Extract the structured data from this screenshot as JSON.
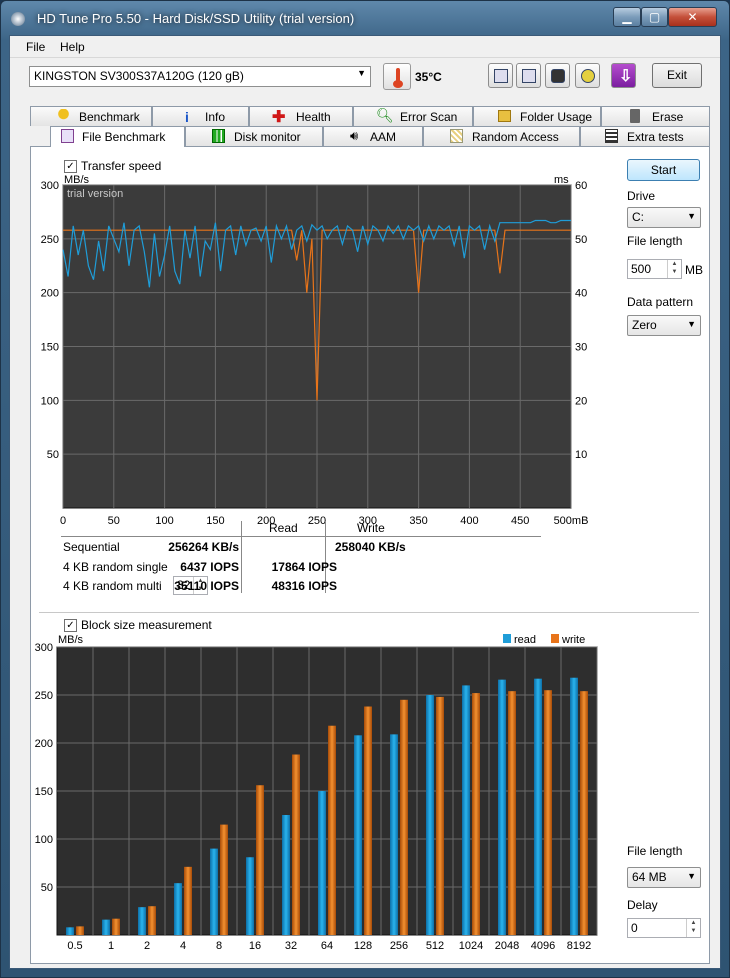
{
  "window": {
    "title": "HD Tune Pro 5.50 - Hard Disk/SSD Utility (trial version)",
    "minimize": "▁",
    "maximize": "▢",
    "close": "✕"
  },
  "menu": {
    "file": "File",
    "help": "Help"
  },
  "toolbar": {
    "drive": "KINGSTON SV300S37A120G (120 gB)",
    "temperature": "35°C",
    "exit": "Exit"
  },
  "tabs_top": [
    "Benchmark",
    "Info",
    "Health",
    "Error Scan",
    "Folder Usage",
    "Erase"
  ],
  "tabs_bottom": [
    "File Benchmark",
    "Disk monitor",
    "AAM",
    "Random Access",
    "Extra tests"
  ],
  "side": {
    "start": "Start",
    "drive_label": "Drive",
    "drive_value": "C:",
    "file_length_label": "File length",
    "file_length_value": "500",
    "file_length_unit": "MB",
    "data_pattern_label": "Data pattern",
    "data_pattern_value": "Zero",
    "file_length2_label": "File length",
    "file_length2_value": "64 MB",
    "delay_label": "Delay",
    "delay_value": "0"
  },
  "transfer": {
    "checkbox_label": "Transfer speed",
    "checked": true,
    "y_unit": "MB/s",
    "y2_unit": "ms",
    "watermark": "trial version",
    "x_unit": "500mB"
  },
  "results": {
    "col_read": "Read",
    "col_write": "Write",
    "rows": [
      {
        "label": "Sequential",
        "read": "256264 KB/s",
        "write": "258040 KB/s"
      },
      {
        "label": "4 KB random single",
        "read": "6437 IOPS",
        "write": "17864 IOPS"
      },
      {
        "label": "4 KB random multi",
        "read": "35110 IOPS",
        "write": "48316 IOPS"
      }
    ],
    "multi_queue": "32"
  },
  "block": {
    "checkbox_label": "Block size measurement",
    "checked": true,
    "y_unit": "MB/s",
    "legend_read": "read",
    "legend_write": "write"
  },
  "colors": {
    "read": "#1f9dd8",
    "write": "#e8741a",
    "plot_bg": "#3a3a3a",
    "grid": "#6e6e6e"
  },
  "chart_data": [
    {
      "type": "line",
      "title": "",
      "ylabel": "MB/s",
      "y2label": "ms",
      "x_ticks": [
        0,
        50,
        100,
        150,
        200,
        250,
        300,
        350,
        400,
        450,
        500
      ],
      "ylim": [
        0,
        300
      ],
      "y2lim": [
        0,
        60
      ],
      "grid": true,
      "series": [
        {
          "name": "",
          "color": "#1f9dd8",
          "axis": "left",
          "x": [
            0,
            5,
            10,
            15,
            20,
            25,
            30,
            35,
            40,
            45,
            50,
            55,
            60,
            65,
            70,
            75,
            80,
            85,
            90,
            95,
            100,
            105,
            110,
            115,
            120,
            125,
            130,
            135,
            140,
            145,
            150,
            155,
            160,
            165,
            170,
            175,
            180,
            185,
            190,
            195,
            200,
            205,
            210,
            215,
            220,
            225,
            230,
            235,
            240,
            245,
            250,
            255,
            260,
            265,
            270,
            275,
            280,
            285,
            290,
            295,
            300,
            305,
            310,
            315,
            320,
            325,
            330,
            335,
            340,
            345,
            350,
            355,
            360,
            365,
            370,
            375,
            380,
            385,
            390,
            395,
            400,
            405,
            410,
            415,
            420,
            425,
            430,
            435,
            440,
            445,
            450,
            455,
            460,
            465,
            470,
            475,
            480,
            485,
            490,
            495,
            500
          ],
          "y": [
            240,
            215,
            262,
            235,
            258,
            225,
            212,
            248,
            220,
            262,
            250,
            238,
            265,
            225,
            258,
            262,
            238,
            205,
            255,
            215,
            235,
            262,
            220,
            208,
            258,
            232,
            262,
            215,
            248,
            240,
            265,
            220,
            258,
            262,
            235,
            262,
            244,
            258,
            260,
            248,
            262,
            228,
            262,
            250,
            262,
            240,
            258,
            262,
            248,
            263,
            258,
            262,
            250,
            258,
            262,
            245,
            262,
            258,
            238,
            262,
            245,
            262,
            258,
            248,
            262,
            255,
            262,
            250,
            262,
            258,
            262,
            248,
            262,
            250,
            262,
            258,
            262,
            244,
            262,
            232,
            262,
            258,
            262,
            240,
            262,
            248,
            265,
            265,
            265,
            265,
            265,
            265,
            265,
            267,
            267,
            267,
            265,
            265,
            267,
            267,
            267
          ]
        },
        {
          "name": "",
          "color": "#e8741a",
          "axis": "left",
          "x": [
            0,
            5,
            10,
            15,
            20,
            25,
            30,
            35,
            40,
            45,
            50,
            55,
            60,
            65,
            70,
            75,
            80,
            85,
            90,
            95,
            100,
            105,
            110,
            115,
            120,
            125,
            130,
            135,
            140,
            145,
            150,
            155,
            160,
            165,
            170,
            175,
            180,
            185,
            190,
            195,
            200,
            205,
            210,
            215,
            220,
            225,
            230,
            235,
            240,
            245,
            250,
            255,
            260,
            265,
            270,
            275,
            280,
            285,
            290,
            295,
            300,
            305,
            310,
            315,
            320,
            325,
            330,
            335,
            340,
            345,
            350,
            355,
            360,
            365,
            370,
            375,
            380,
            385,
            390,
            395,
            400,
            405,
            410,
            415,
            420,
            425,
            430,
            435,
            440,
            445,
            450,
            455,
            460,
            465,
            470,
            475,
            480,
            485,
            490,
            495,
            500
          ],
          "y": [
            258,
            258,
            258,
            258,
            258,
            258,
            258,
            258,
            258,
            258,
            258,
            258,
            258,
            258,
            258,
            258,
            258,
            258,
            258,
            258,
            258,
            258,
            258,
            258,
            258,
            258,
            258,
            258,
            258,
            258,
            258,
            258,
            258,
            258,
            258,
            258,
            258,
            258,
            258,
            258,
            258,
            258,
            258,
            258,
            258,
            258,
            230,
            258,
            200,
            250,
            100,
            258,
            258,
            258,
            258,
            258,
            258,
            258,
            258,
            258,
            258,
            258,
            258,
            258,
            258,
            258,
            258,
            258,
            258,
            258,
            200,
            258,
            258,
            258,
            258,
            258,
            258,
            258,
            258,
            258,
            258,
            258,
            258,
            258,
            258,
            258,
            218,
            258,
            258,
            258,
            258,
            258,
            258,
            258,
            258,
            258,
            258,
            258,
            258,
            258,
            258
          ]
        }
      ]
    },
    {
      "type": "bar",
      "title": "",
      "ylabel": "MB/s",
      "ylim": [
        0,
        300
      ],
      "grid": true,
      "categories": [
        "0.5",
        "1",
        "2",
        "4",
        "8",
        "16",
        "32",
        "64",
        "128",
        "256",
        "512",
        "1024",
        "2048",
        "4096",
        "8192"
      ],
      "series": [
        {
          "name": "read",
          "color": "#1f9dd8",
          "values": [
            8,
            16,
            29,
            54,
            90,
            81,
            125,
            150,
            208,
            209,
            250,
            260,
            266,
            267,
            268
          ]
        },
        {
          "name": "write",
          "color": "#e8741a",
          "values": [
            9,
            17,
            30,
            71,
            115,
            156,
            188,
            218,
            238,
            245,
            248,
            252,
            254,
            255,
            254
          ]
        }
      ]
    }
  ]
}
